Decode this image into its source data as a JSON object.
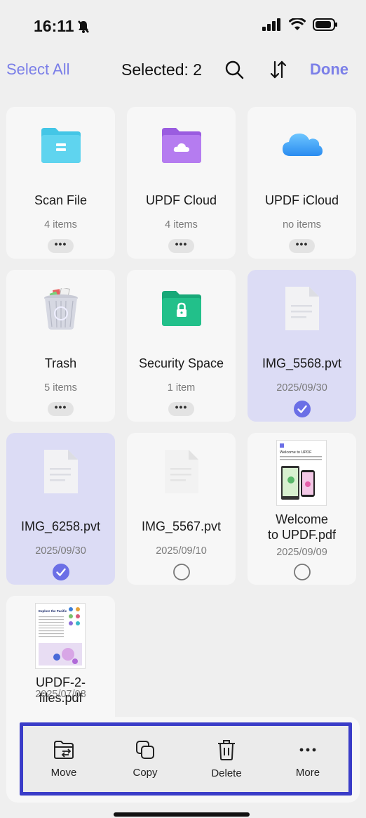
{
  "status": {
    "time": "16:11"
  },
  "nav": {
    "select_all": "Select All",
    "title": "Selected: 2",
    "done": "Done"
  },
  "items": [
    {
      "name": "Scan File",
      "sub": "4 items",
      "icon": "blue-folder-icon"
    },
    {
      "name": "UPDF Cloud",
      "sub": "4 items",
      "icon": "purple-cloud-folder-icon"
    },
    {
      "name": "UPDF iCloud",
      "sub": "no items",
      "icon": "icloud-icon"
    },
    {
      "name": "Trash",
      "sub": "5 items",
      "icon": "trash-can-icon"
    },
    {
      "name": "Security Space",
      "sub": "1 item",
      "icon": "lock-folder-icon"
    },
    {
      "name": "IMG_5568.pvt",
      "sub": "2025/09/30",
      "icon": "document-icon",
      "selected": true
    },
    {
      "name": "IMG_6258.pvt",
      "sub": "2025/09/30",
      "icon": "document-icon",
      "selected": true
    },
    {
      "name": "IMG_5567.pvt",
      "sub": "2025/09/10",
      "icon": "document-icon",
      "selected": false
    },
    {
      "name_line1": "Welcome",
      "name_line2": "to UPDF.pdf",
      "sub": "2025/09/09",
      "icon": "pdf-thumbnail",
      "selected": false
    },
    {
      "name_line1": "UPDF-2-",
      "name_line2": "files.pdf",
      "sub": "2025/07/08",
      "icon": "pdf-thumbnail"
    }
  ],
  "more_dots": "•••",
  "thumb_text": {
    "welcome": "Welcome to UPDF",
    "explore": "Explore the Pacific"
  },
  "toolbar": {
    "move": "Move",
    "copy": "Copy",
    "delete": "Delete",
    "more": "More"
  },
  "colors": {
    "accent": "#7b7fe8",
    "selected_bg": "#dcdcf5",
    "highlight_border": "#3a3cc8"
  }
}
